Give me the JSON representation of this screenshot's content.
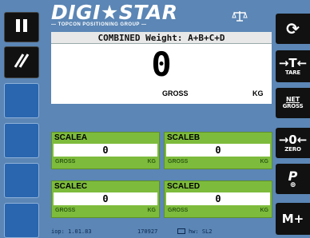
{
  "header": {
    "brand": "DIGI★STAR",
    "brand_sub": "— TOPCON POSITIONING GROUP —",
    "scale_icon": "scale-icon"
  },
  "main_display": {
    "title": "COMBINED Weight: A+B+C+D",
    "weight": "0",
    "mode": "GROSS",
    "unit": "KG"
  },
  "scales": [
    {
      "name": "SCALEA",
      "value": "0",
      "mode": "GROSS",
      "unit": "KG"
    },
    {
      "name": "SCALEB",
      "value": "0",
      "mode": "GROSS",
      "unit": "KG"
    },
    {
      "name": "SCALEC",
      "value": "0",
      "mode": "GROSS",
      "unit": "KG"
    },
    {
      "name": "SCALED",
      "value": "0",
      "mode": "GROSS",
      "unit": "KG"
    }
  ],
  "right_buttons": [
    {
      "big": "⟳",
      "small": ""
    },
    {
      "big": "→T←",
      "small": "TARE"
    },
    {
      "big": "NET",
      "small": "GROSS"
    },
    {
      "big": "→0←",
      "small": "ZERO"
    },
    {
      "big": "P",
      "small": "⊕"
    },
    {
      "big": "M+",
      "small": ""
    }
  ],
  "left_buttons": [
    {
      "icon": "pause-icon",
      "glyph": "❚❚"
    },
    {
      "icon": "hatch-icon",
      "glyph": "///"
    }
  ],
  "footer": {
    "app": "iop: 1.01.83",
    "serial": "170927",
    "ver": "hw: SL2"
  },
  "colors": {
    "background": "#5b86b5",
    "panel_green": "#7dbb3c",
    "button_black": "#111111",
    "button_blue": "#2a66b0"
  }
}
